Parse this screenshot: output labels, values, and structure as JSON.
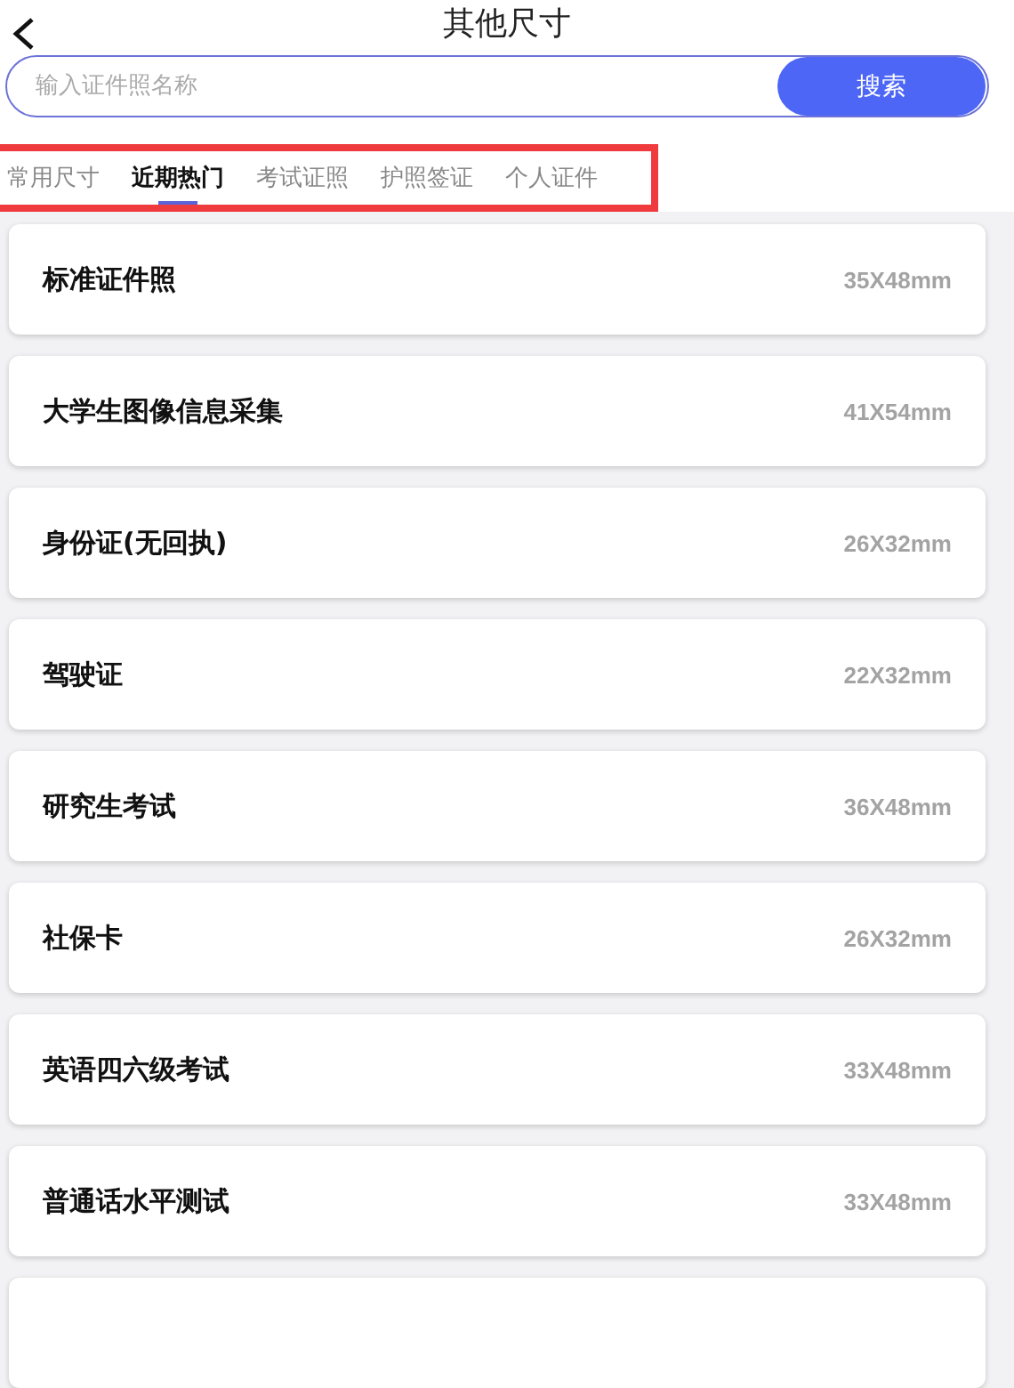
{
  "header": {
    "title": "其他尺寸"
  },
  "search": {
    "placeholder": "输入证件照名称",
    "button": "搜索"
  },
  "tabs": [
    {
      "label": "常用尺寸",
      "selected": false
    },
    {
      "label": "近期热门",
      "selected": true
    },
    {
      "label": "考试证照",
      "selected": false
    },
    {
      "label": "护照签证",
      "selected": false
    },
    {
      "label": "个人证件",
      "selected": false
    }
  ],
  "items": [
    {
      "name": "标准证件照",
      "size": "35X48mm"
    },
    {
      "name": "大学生图像信息采集",
      "size": "41X54mm"
    },
    {
      "name": "身份证(无回执)",
      "size": "26X32mm"
    },
    {
      "name": "驾驶证",
      "size": "22X32mm"
    },
    {
      "name": "研究生考试",
      "size": "36X48mm"
    },
    {
      "name": "社保卡",
      "size": "26X32mm"
    },
    {
      "name": "英语四六级考试",
      "size": "33X48mm"
    },
    {
      "name": "普通话水平测试",
      "size": "33X48mm"
    }
  ]
}
